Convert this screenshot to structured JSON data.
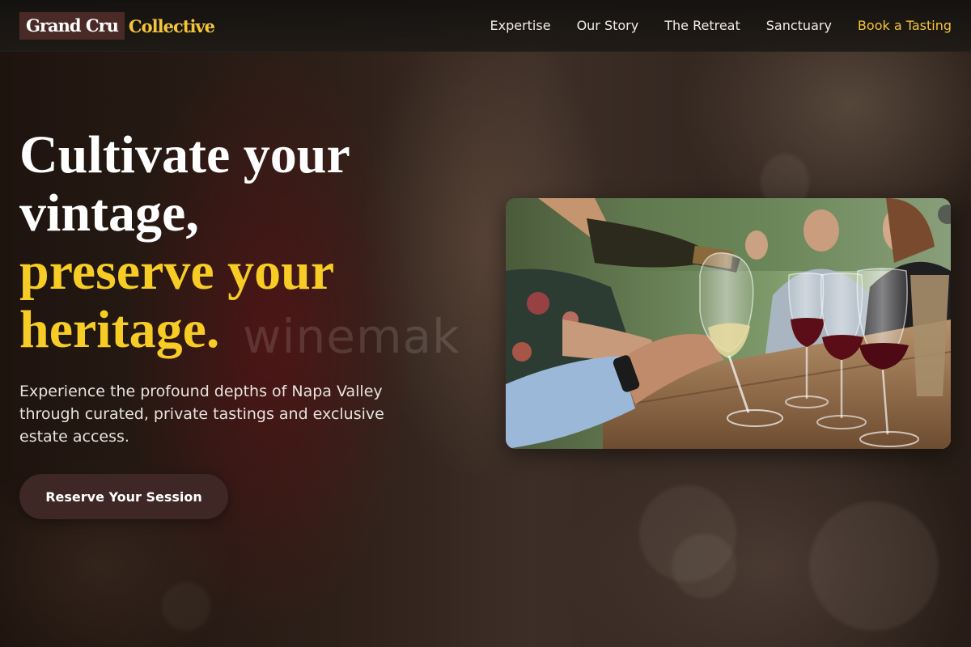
{
  "brand": {
    "name_primary": "Grand Cru",
    "name_secondary": "Collective"
  },
  "nav": {
    "items": [
      {
        "label": "Expertise"
      },
      {
        "label": "Our Story"
      },
      {
        "label": "The Retreat"
      },
      {
        "label": "Sanctuary"
      }
    ],
    "cta_label": "Book a Tasting"
  },
  "hero": {
    "headline_line1": "Cultivate your",
    "headline_line2": "vintage,",
    "headline_line3": "preserve your",
    "headline_line4": "heritage.",
    "subtext": "Experience the profound depths of Napa Valley through curated, private tastings and exclusive estate access.",
    "button_label": "Reserve Your Session",
    "watermark": "winemak"
  },
  "colors": {
    "accent_gold": "#f6cc25",
    "nav_cta": "#f3c538",
    "button_bg": "#3e2724",
    "logo_bg": "#4a2a26"
  }
}
